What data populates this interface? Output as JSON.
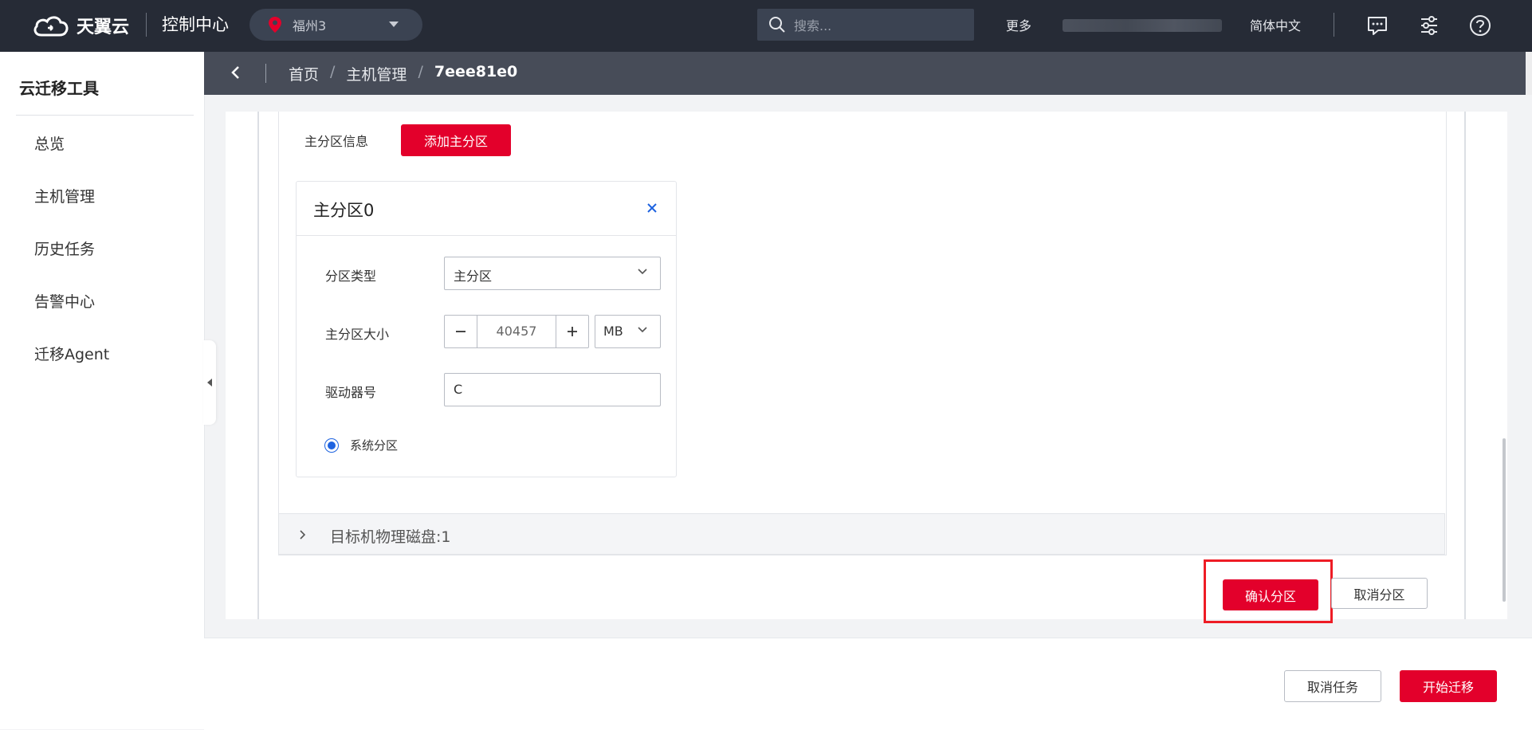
{
  "header": {
    "logo_text": "天翼云",
    "console_title": "控制中心",
    "region": "福州3",
    "search_placeholder": "搜索...",
    "more": "更多",
    "language": "简体中文"
  },
  "sidebar": {
    "title": "云迁移工具",
    "items": [
      {
        "label": "总览"
      },
      {
        "label": "主机管理"
      },
      {
        "label": "历史任务"
      },
      {
        "label": "告警中心"
      },
      {
        "label": "迁移Agent"
      }
    ]
  },
  "breadcrumb": {
    "items": [
      "首页",
      "主机管理",
      "7eee81e0"
    ]
  },
  "partition_section": {
    "label": "主分区信息",
    "add_button": "添加主分区",
    "card": {
      "title": "主分区0",
      "type_label": "分区类型",
      "type_value": "主分区",
      "size_label": "主分区大小",
      "size_value": "40457",
      "unit_value": "MB",
      "drive_label": "驱动器号",
      "drive_value": "C",
      "system_partition_label": "系统分区",
      "system_partition_checked": true
    }
  },
  "target_disk": {
    "label": "目标机物理磁盘:1"
  },
  "actions": {
    "confirm_partition": "确认分区",
    "cancel_partition": "取消分区"
  },
  "footer": {
    "cancel_task": "取消任务",
    "start_migration": "开始迁移"
  },
  "colors": {
    "primary_red": "#e3002b",
    "topbar_bg": "#262b36",
    "breadcrumb_bg": "#474c58",
    "radio_blue": "#1e63e0",
    "highlight_red": "#ee1c25"
  }
}
